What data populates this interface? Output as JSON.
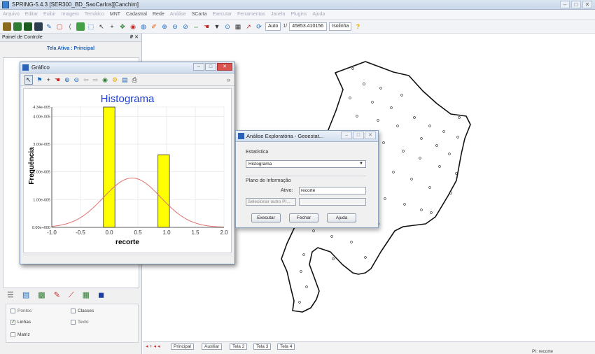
{
  "window": {
    "title": "SPRING-5.4.3 [SER300_BD_SaoCarlos][Canchim]",
    "min": "–",
    "max": "□",
    "close": "✕"
  },
  "menu": [
    "Arquivo",
    "Editar",
    "Exibir",
    "Imagem",
    "Temático",
    "MNT",
    "Cadastral",
    "Rede",
    "Análise",
    "SCarta",
    "Executar",
    "Ferramentas",
    "Janela",
    "Plugins",
    "Ajuda"
  ],
  "toolbar": {
    "scale_mode": "Auto",
    "scale_sep": "1/",
    "scale_value": "45853.410156",
    "mode_select": "Isolinha"
  },
  "panel": {
    "title": "Painel de Controle",
    "pin": "₽ ✕",
    "subtitle": "Tela Ativa : Principal",
    "checks": [
      {
        "label": "Pontos",
        "checked": false
      },
      {
        "label": "Classes",
        "checked": false
      },
      {
        "label": "Linhas",
        "checked": true
      },
      {
        "label": "Texto",
        "checked": false
      },
      {
        "label": "Matriz",
        "checked": false
      }
    ]
  },
  "grafico": {
    "title": "Gráfico"
  },
  "chart_data": {
    "type": "bar",
    "title": "Histograma",
    "xlabel": "recorte",
    "ylabel": "Frequência",
    "xlim": [
      -1.0,
      2.0
    ],
    "ylim": [
      0,
      4.34e-05
    ],
    "x_ticks": [
      "-1.0",
      "-0.5",
      "0.0",
      "0.5",
      "1.0",
      "1.5",
      "2.0"
    ],
    "y_ticks": [
      "0.00e+000",
      "1.00e-005",
      "2.00e-005",
      "3.00e-005",
      "4.00e-005",
      "4.34e-005"
    ],
    "bars": [
      {
        "x0": -0.1,
        "x1": 0.1,
        "value": 4.34e-05
      },
      {
        "x0": 0.85,
        "x1": 1.05,
        "value": 2.62e-05
      }
    ],
    "normal_curve": {
      "mean": 0.4,
      "sd": 0.5,
      "peak": 1.78e-05,
      "color": "#e07070"
    },
    "bar_color": "#ffff00"
  },
  "analise": {
    "title": "Análise Exploratória - Geoestat...",
    "section1": "Estatística",
    "select_value": "Histograma",
    "section2": "Plano de Informação",
    "ativo_label": "Ativo:",
    "ativo_value": "recorte",
    "outro_button": "Selecionar outro PI...",
    "btn_executar": "Executar",
    "btn_fechar": "Fechar",
    "btn_ajuda": "Ajuda"
  },
  "tabs": {
    "nav": "◂ + ◂ ◂",
    "items": [
      "Principal",
      "Auxiliar",
      "Tela 2",
      "Tela 3",
      "Tela 4"
    ]
  },
  "status": "PI: recorte"
}
